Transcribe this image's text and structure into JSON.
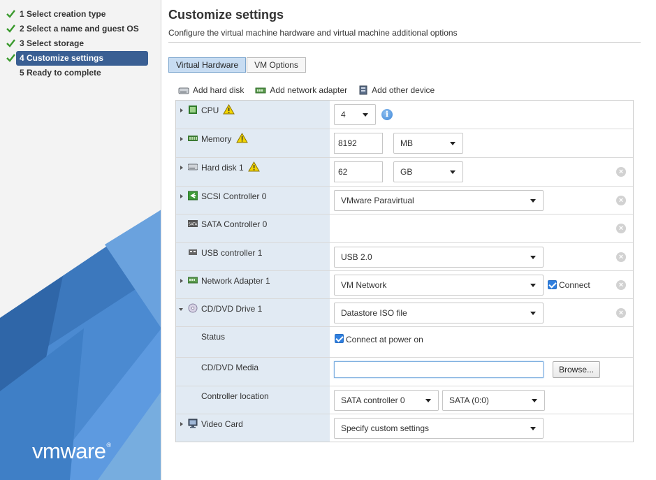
{
  "wizard": {
    "steps": [
      {
        "label": "1 Select creation type",
        "completed": true,
        "active": false
      },
      {
        "label": "2 Select a name and guest OS",
        "completed": true,
        "active": false
      },
      {
        "label": "3 Select storage",
        "completed": true,
        "active": false
      },
      {
        "label": "4 Customize settings",
        "completed": true,
        "active": true
      },
      {
        "label": "5 Ready to complete",
        "completed": false,
        "active": false
      }
    ],
    "brand": "vmware",
    "brand_mark": "®"
  },
  "page": {
    "title": "Customize settings",
    "subtitle": "Configure the virtual machine hardware and virtual machine additional options"
  },
  "tabs": [
    {
      "label": "Virtual Hardware",
      "active": true
    },
    {
      "label": "VM Options",
      "active": false
    }
  ],
  "toolbar": {
    "add_hard_disk": "Add hard disk",
    "add_network_adapter": "Add network adapter",
    "add_other_device": "Add other device"
  },
  "hardware": {
    "cpu": {
      "label": "CPU",
      "value": "4",
      "warning": true
    },
    "memory": {
      "label": "Memory",
      "value": "8192",
      "unit": "MB",
      "warning": true
    },
    "hard_disk": {
      "label": "Hard disk 1",
      "value": "62",
      "unit": "GB",
      "warning": true
    },
    "scsi": {
      "label": "SCSI Controller 0",
      "value": "VMware Paravirtual"
    },
    "sata": {
      "label": "SATA Controller 0"
    },
    "usb": {
      "label": "USB controller 1",
      "value": "USB 2.0"
    },
    "network": {
      "label": "Network Adapter 1",
      "value": "VM Network",
      "connect_label": "Connect",
      "connected": true
    },
    "cdrom": {
      "label": "CD/DVD Drive 1",
      "value": "Datastore ISO file",
      "status_label": "Status",
      "status_checkbox_label": "Connect at power on",
      "media_label": "CD/DVD Media",
      "media_value": "",
      "browse_label": "Browse...",
      "controller_location_label": "Controller location",
      "controller_value": "SATA controller 0",
      "port_value": "SATA (0:0)"
    },
    "video": {
      "label": "Video Card",
      "value": "Specify custom settings"
    }
  },
  "colors": {
    "active_step": "#3a5f93",
    "label_column": "#e1eaf3",
    "active_tab": "#c7dcf2",
    "sidebar_blue": "#4f8fd1",
    "warning": "#f2d400"
  }
}
